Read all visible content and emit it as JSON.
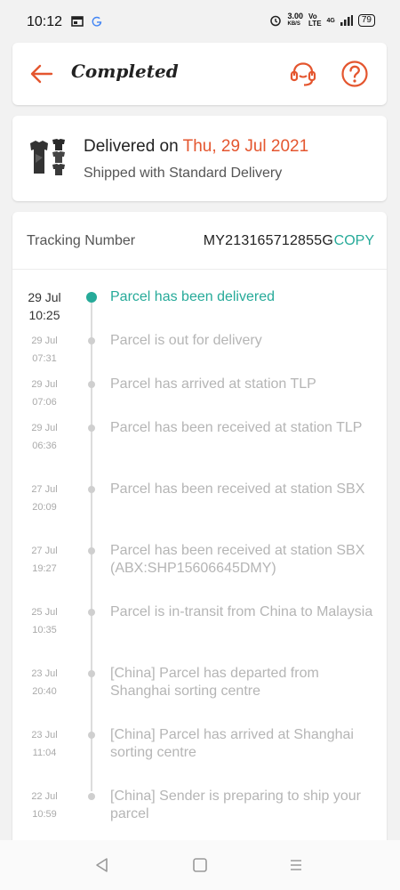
{
  "status_bar": {
    "time": "10:12",
    "speed": "3.00",
    "speed_unit": "KB/S",
    "network": "4G",
    "battery": "79"
  },
  "header": {
    "title": "Completed"
  },
  "delivery": {
    "prefix": "Delivered on ",
    "date": "Thu, 29 Jul 2021",
    "shipping": "Shipped with Standard Delivery"
  },
  "tracking": {
    "label": "Tracking Number",
    "number": "MY213165712855G",
    "copy_label": "COPY",
    "events": [
      {
        "date": "29 Jul",
        "time": "10:25",
        "text": "Parcel has been delivered"
      },
      {
        "date": "29 Jul",
        "time": "07:31",
        "text": "Parcel is out for delivery"
      },
      {
        "date": "29 Jul",
        "time": "07:06",
        "text": "Parcel has arrived at station TLP"
      },
      {
        "date": "29 Jul",
        "time": "06:36",
        "text": "Parcel has been received at station TLP"
      },
      {
        "date": "27 Jul",
        "time": "20:09",
        "text": "Parcel has been received at station SBX"
      },
      {
        "date": "27 Jul",
        "time": "19:27",
        "text": "Parcel has been received at station SBX (ABX:SHP15606645DMY)"
      },
      {
        "date": "25 Jul",
        "time": "10:35",
        "text": "Parcel is in-transit from China to Malaysia"
      },
      {
        "date": "23 Jul",
        "time": "20:40",
        "text": "[China] Parcel has departed from Shanghai sorting centre"
      },
      {
        "date": "23 Jul",
        "time": "11:04",
        "text": "[China] Parcel has arrived at Shanghai sorting centre"
      },
      {
        "date": "22 Jul",
        "time": "10:59",
        "text": "[China] Sender is preparing to ship your parcel"
      }
    ]
  },
  "colors": {
    "accent": "#e4562f",
    "teal": "#26aa99",
    "muted": "#b5b5b5"
  },
  "icons": {
    "back": "arrow-left-icon",
    "support": "headset-icon",
    "help": "question-icon"
  }
}
